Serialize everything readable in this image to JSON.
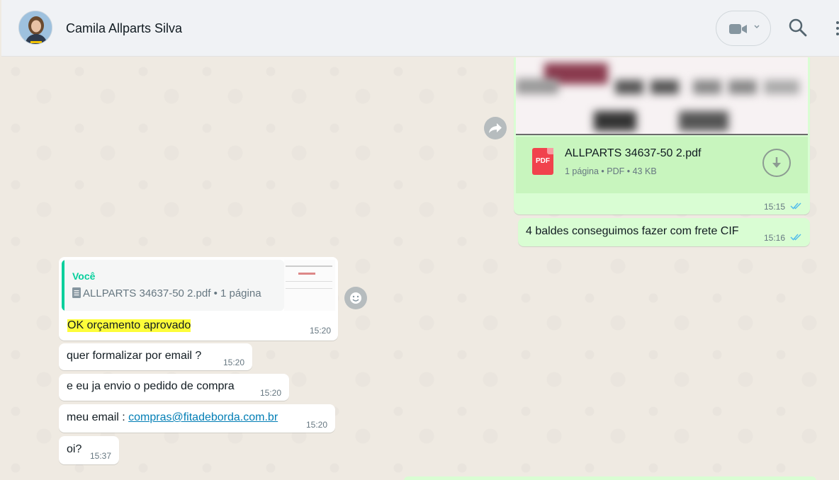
{
  "header": {
    "contact_name": "Camila Allparts Silva",
    "icons": [
      "video-call-icon",
      "chevron-down-icon",
      "search-icon",
      "menu-icon"
    ]
  },
  "messages": {
    "pdf": {
      "file_name": "ALLPARTS 34637-50 2.pdf",
      "meta": "1 página • PDF • 43 KB",
      "icon_label": "PDF",
      "time": "15:15",
      "status": "read"
    },
    "out_text": {
      "text": "4 baldes conseguimos fazer com frete CIF",
      "time": "15:16",
      "status": "read"
    },
    "reply": {
      "quote_author": "Você",
      "quote_doc": "ALLPARTS 34637-50 2.pdf • 1 página",
      "text": "OK orçamento aprovado",
      "time": "15:20"
    },
    "in1": {
      "text": "quer formalizar por email ?",
      "time": "15:20"
    },
    "in2": {
      "text": "e eu ja envio o pedido de compra",
      "time": "15:20"
    },
    "in3": {
      "prefix": "meu email : ",
      "link": "compras@fitadeborda.com.br",
      "time": "15:20"
    },
    "in4": {
      "text": "oi?",
      "time": "15:37"
    }
  },
  "colors": {
    "outgoing_bubble": "#d9fdd3",
    "incoming_bubble": "#ffffff",
    "read_ticks": "#53bdeb",
    "quote_accent": "#06cf9c",
    "highlight": "#fdfd3a",
    "pdf_red": "#f1424d"
  }
}
